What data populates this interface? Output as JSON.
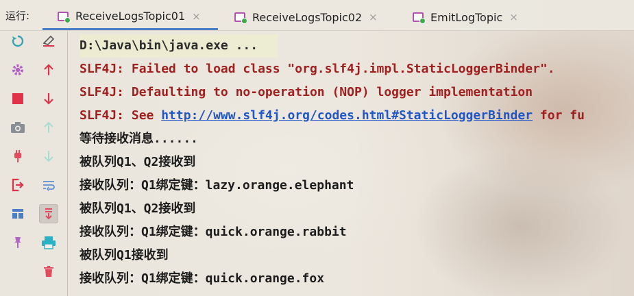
{
  "tabbar": {
    "run_label": "运行:",
    "tabs": [
      {
        "label": "ReceiveLogsTopic01",
        "active": true,
        "close": "×"
      },
      {
        "label": "ReceiveLogsTopic02",
        "active": false,
        "close": "×"
      },
      {
        "label": "EmitLogTopic",
        "active": false,
        "close": "×"
      }
    ]
  },
  "toolbar": {
    "left": [
      "rerun-icon",
      "settings-icon",
      "stop-icon",
      "camera-icon",
      "plug-icon",
      "exit-icon",
      "layout-icon",
      "pin-icon"
    ],
    "right": [
      "clear-icon",
      "up-arrow-icon",
      "down-arrow-icon",
      "up-arrow-disabled-icon",
      "down-arrow-disabled-icon",
      "wrap-icon",
      "scroll-to-end-icon",
      "print-icon",
      "trash-icon"
    ]
  },
  "console": {
    "cmd": "D:\\Java\\bin\\java.exe ...",
    "err1": "SLF4J: Failed to load class \"org.slf4j.impl.StaticLoggerBinder\".",
    "err2": "SLF4J: Defaulting to no-operation (NOP) logger implementation",
    "err3_prefix": "SLF4J: See ",
    "err3_link": "http://www.slf4j.org/codes.html#StaticLoggerBinder",
    "err3_suffix": " for fu",
    "out": [
      "等待接收消息......",
      "被队列Q1、Q2接收到",
      "接收队列：Q1绑定键：lazy.orange.elephant",
      "被队列Q1、Q2接收到",
      "接收队列：Q1绑定键：quick.orange.rabbit",
      "被队列Q1接收到",
      "接收队列：Q1绑定键：quick.orange.fox"
    ]
  },
  "colors": {
    "error": "#a01f1f",
    "link": "#2156c9",
    "accent": "#4a7fc8",
    "tab_icon": "#b253b0"
  }
}
